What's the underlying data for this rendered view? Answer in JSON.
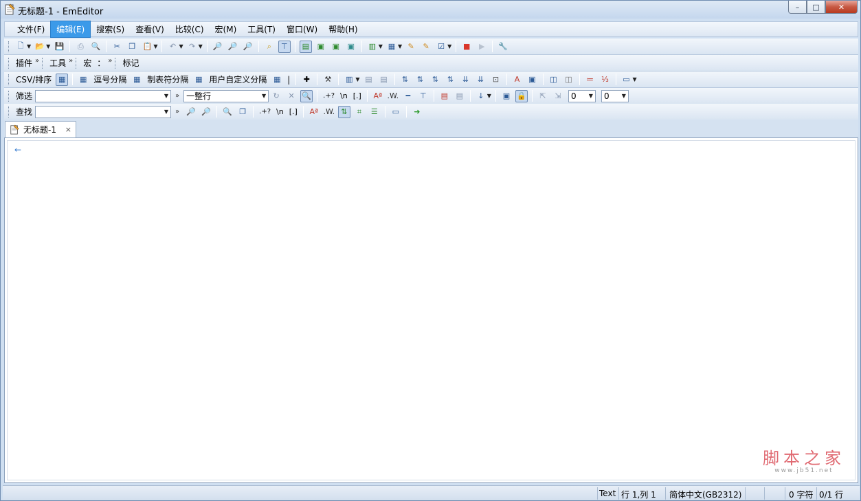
{
  "window": {
    "title": "无标题-1 - EmEditor",
    "caption": {
      "minimize": "–",
      "maximize": "□",
      "close": "✕"
    }
  },
  "menu": {
    "items": [
      {
        "label": "文件(F)"
      },
      {
        "label": "编辑(E)"
      },
      {
        "label": "搜索(S)"
      },
      {
        "label": "查看(V)"
      },
      {
        "label": "比较(C)"
      },
      {
        "label": "宏(M)"
      },
      {
        "label": "工具(T)"
      },
      {
        "label": "窗口(W)"
      },
      {
        "label": "帮助(H)"
      }
    ],
    "active_index": 1
  },
  "toolbar_labels": {
    "plugins": "插件",
    "tools": "工具",
    "macros": "宏",
    "macro_colon": "：",
    "markers": "标记",
    "chevron": "»"
  },
  "csv_bar": {
    "csv_sort": "CSV/排序",
    "comma": "逗号分隔",
    "tab": "制表符分隔",
    "user": "用户自定义分隔",
    "pipe": "|"
  },
  "filter_bar": {
    "label": "筛选",
    "input_value": "",
    "mode_value": "一整行",
    "regex": ".+?",
    "newline": "\\n",
    "bracket": "[.]",
    "num1": "0",
    "num2": "0"
  },
  "find_bar": {
    "label": "查找",
    "input_value": "",
    "regex": ".+?",
    "newline": "\\n",
    "bracket": "[.]"
  },
  "tab": {
    "label": "无标题-1",
    "close": "×"
  },
  "editor": {
    "newline_mark": "←"
  },
  "watermark": {
    "main": "脚本之家",
    "sub": "www.jb51.net"
  },
  "status": {
    "mode": "Text",
    "position": "行 1,列 1",
    "encoding": "简体中文(GB2312)",
    "chars": "0 字符",
    "lines": "0/1 行"
  }
}
